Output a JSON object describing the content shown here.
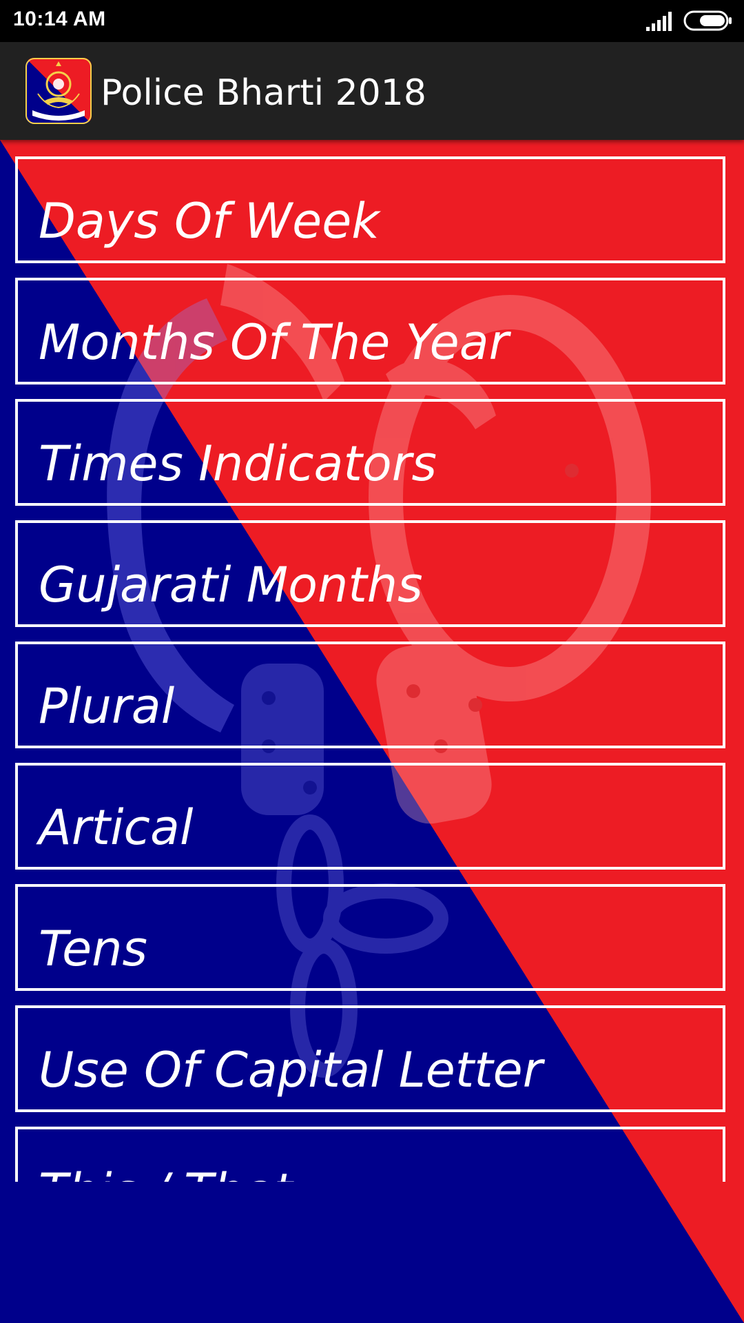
{
  "status_bar": {
    "time": "10:14 AM",
    "signal_icon": "cellular-signal-icon",
    "battery_icon": "battery-icon"
  },
  "app_bar": {
    "title": "Police Bharti 2018",
    "logo_icon": "gujarat-police-emblem-icon"
  },
  "background": {
    "icon": "handcuffs-icon",
    "colors": {
      "red": "#ED1C24",
      "blue": "#00008B"
    }
  },
  "list": {
    "items": [
      {
        "label": "Days Of Week"
      },
      {
        "label": "Months Of The Year"
      },
      {
        "label": "Times Indicators"
      },
      {
        "label": "Gujarati Months"
      },
      {
        "label": "Plural"
      },
      {
        "label": "Artical"
      },
      {
        "label": "Tens"
      },
      {
        "label": "Use Of Capital Letter"
      },
      {
        "label": "This / That"
      }
    ]
  }
}
